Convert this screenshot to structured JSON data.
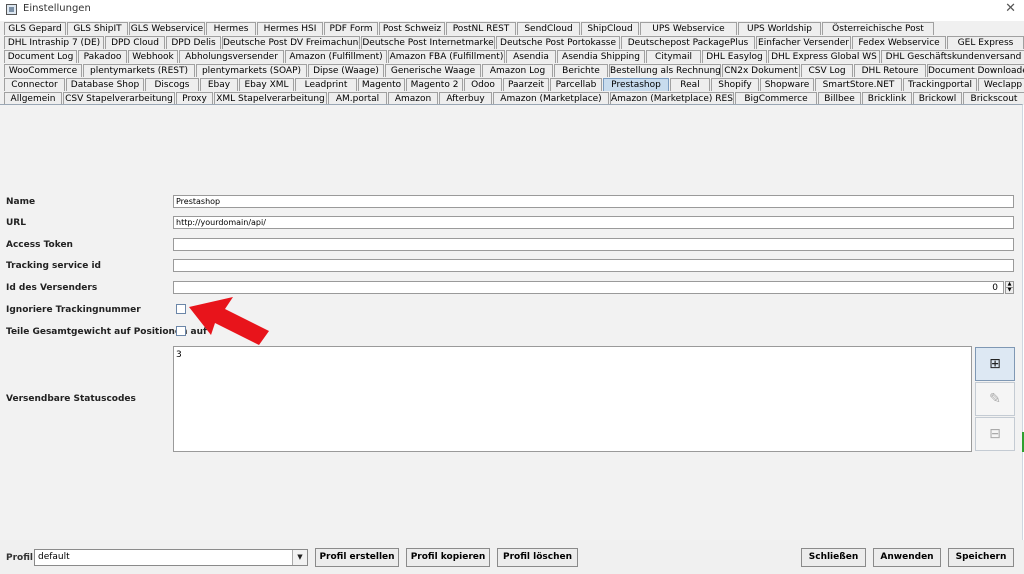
{
  "window": {
    "title": "Einstellungen",
    "close_glyph": "✕"
  },
  "tab_rows": [
    [
      "GLS Gepard",
      "GLS ShipIT",
      "GLS Webservice",
      "Hermes",
      "Hermes HSI",
      "PDF Form",
      "Post Schweiz",
      "PostNL REST",
      "SendCloud",
      "ShipCloud",
      "UPS Webservice",
      "UPS Worldship",
      "Österreichische Post"
    ],
    [
      "DHL Intraship 7 (DE)",
      "DPD Cloud",
      "DPD Delis",
      "Deutsche Post DV Freimachung",
      "Deutsche Post Internetmarke",
      "Deutsche Post Portokasse",
      "Deutschepost PackagePlus",
      "Einfacher Versender",
      "Fedex Webservice",
      "GEL Express"
    ],
    [
      "Document Log",
      "Pakadoo",
      "Webhook",
      "Abholungsversender",
      "Amazon (Fulfillment)",
      "Amazon FBA (Fulfillment)",
      "Asendia",
      "Asendia Shipping",
      "Citymail",
      "DHL Easylog",
      "DHL Express Global WS",
      "DHL Geschäftskundenversand"
    ],
    [
      "WooCommerce",
      "plentymarkets (REST)",
      "plentymarkets (SOAP)",
      "Dipse (Waage)",
      "Generische Waage",
      "Amazon Log",
      "Berichte",
      "Bestellung als Rechnung",
      "CN2x Dokument",
      "CSV Log",
      "DHL Retoure",
      "Document Downloader"
    ],
    [
      "Connector",
      "Database Shop",
      "Discogs",
      "Ebay",
      "Ebay XML",
      "Leadprint",
      "Magento",
      "Magento 2",
      "Odoo",
      "Paarzeit",
      "Parcellab",
      "Prestashop",
      "Real",
      "Shopify",
      "Shopware",
      "SmartStore.NET",
      "Trackingportal",
      "Weclapp"
    ],
    [
      "Allgemein",
      "CSV Stapelverarbeitung",
      "Proxy",
      "XML Stapelverarbeitung",
      "AM.portal",
      "Amazon",
      "Afterbuy",
      "Amazon (Marketplace)",
      "Amazon (Marketplace) REST",
      "BigCommerce",
      "Billbee",
      "Bricklink",
      "Brickowl",
      "Brickscout"
    ]
  ],
  "active_tab": "Prestashop",
  "form": {
    "name_label": "Name",
    "name_value": "Prestashop",
    "url_label": "URL",
    "url_value": "http://yourdomain/api/",
    "token_label": "Access Token",
    "token_value": "",
    "tracking_id_label": "Tracking service id",
    "tracking_id_value": "",
    "sender_id_label": "Id des Versenders",
    "sender_id_value": "0",
    "ignore_tracking_label": "Ignoriere Trackingnummer",
    "ignore_tracking_checked": false,
    "split_weight_label": "Teile Gesamtgewicht auf Positionen auf",
    "split_weight_checked": false,
    "status_codes_label": "Versendbare Statuscodes",
    "status_codes_value": "3"
  },
  "side_buttons": {
    "add_icon": "⊞",
    "edit_icon": "✎",
    "remove_icon": "⊟"
  },
  "annotation": {
    "arrow_color": "#e8141b"
  },
  "bottom": {
    "profile_label": "Profil",
    "profile_value": "default",
    "dropdown_glyph": "▼",
    "create_label": "Profil erstellen",
    "copy_label": "Profil kopieren",
    "delete_label": "Profil löschen",
    "close_label": "Schließen",
    "apply_label": "Anwenden",
    "save_label": "Speichern"
  }
}
